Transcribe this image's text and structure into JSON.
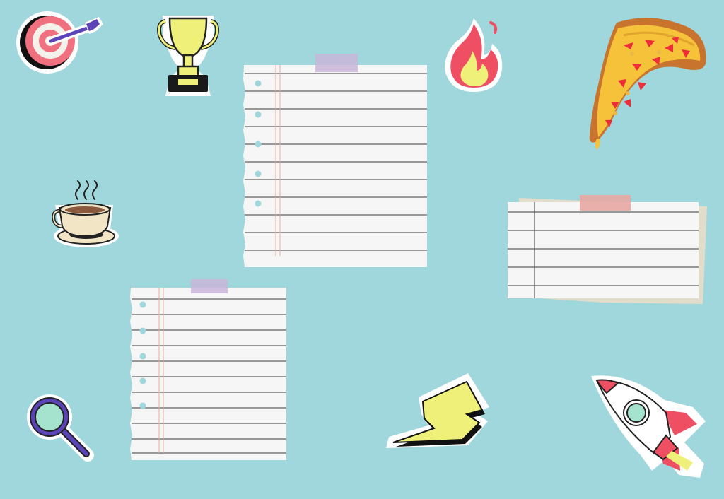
{
  "colors": {
    "background": "#9fd7dc",
    "paper": "#f6f6f6",
    "rule_line": "#3a3a3a",
    "margin_line": "#e8a9a0",
    "tape_purple": "#c9b6d9",
    "tape_pink": "#e8a8a3",
    "tan_backing": "#e2dccb",
    "sticker_border": "#ffffff"
  },
  "icons": [
    "target-dart-icon",
    "trophy-icon",
    "flame-icon",
    "pizza-slice-icon",
    "coffee-cup-icon",
    "magnifier-icon",
    "lightning-bolt-icon",
    "rocket-icon"
  ]
}
